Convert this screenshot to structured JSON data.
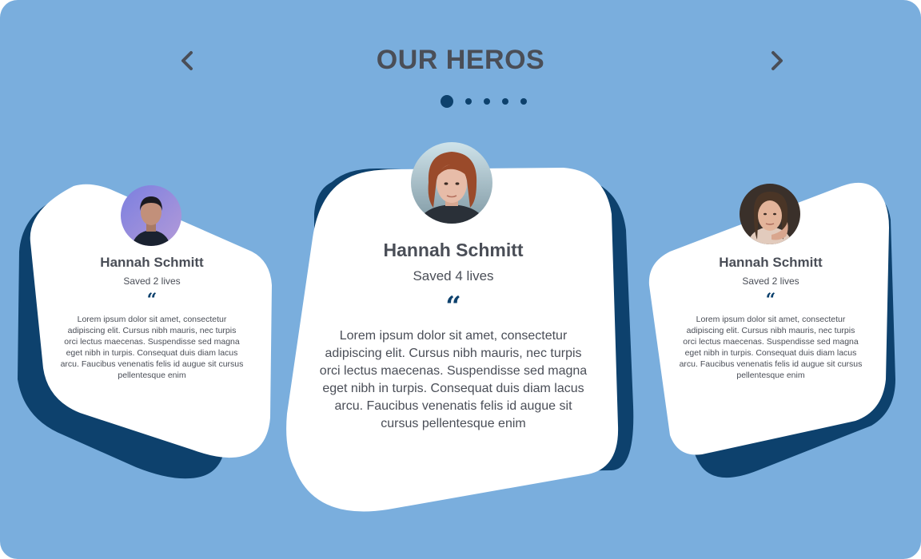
{
  "header": {
    "title": "OUR HEROS",
    "prev_icon": "chevron-left-icon",
    "next_icon": "chevron-right-icon"
  },
  "pagination": {
    "count": 5,
    "active_index": 0
  },
  "colors": {
    "background": "#7aaedd",
    "accent": "#0d416d",
    "card": "#ffffff",
    "text": "#4a4e57"
  },
  "cards": [
    {
      "name": "Hannah Schmitt",
      "subtitle": "Saved 2 lives",
      "quote_mark": "“",
      "text": "Lorem ipsum dolor sit amet, consectetur adipiscing elit. Cursus nibh mauris, nec turpis orci lectus maecenas. Suspendisse sed magna eget nibh in turpis. Consequat duis diam lacus arcu. Faucibus venenatis felis id augue sit cursus pellentesque enim"
    },
    {
      "name": "Hannah Schmitt",
      "subtitle": "Saved 4 lives",
      "quote_mark": "“",
      "text": "Lorem ipsum dolor sit amet, consectetur adipiscing elit. Cursus nibh mauris, nec turpis orci lectus maecenas. Suspendisse sed magna eget nibh in turpis. Consequat duis diam lacus arcu. Faucibus venenatis felis id augue sit cursus pellentesque enim"
    },
    {
      "name": "Hannah Schmitt",
      "subtitle": "Saved 2 lives",
      "quote_mark": "“",
      "text": "Lorem ipsum dolor sit amet, consectetur adipiscing elit. Cursus nibh mauris, nec turpis orci lectus maecenas. Suspendisse sed magna eget nibh in turpis. Consequat duis diam lacus arcu. Faucibus venenatis felis id augue sit cursus pellentesque enim"
    }
  ]
}
